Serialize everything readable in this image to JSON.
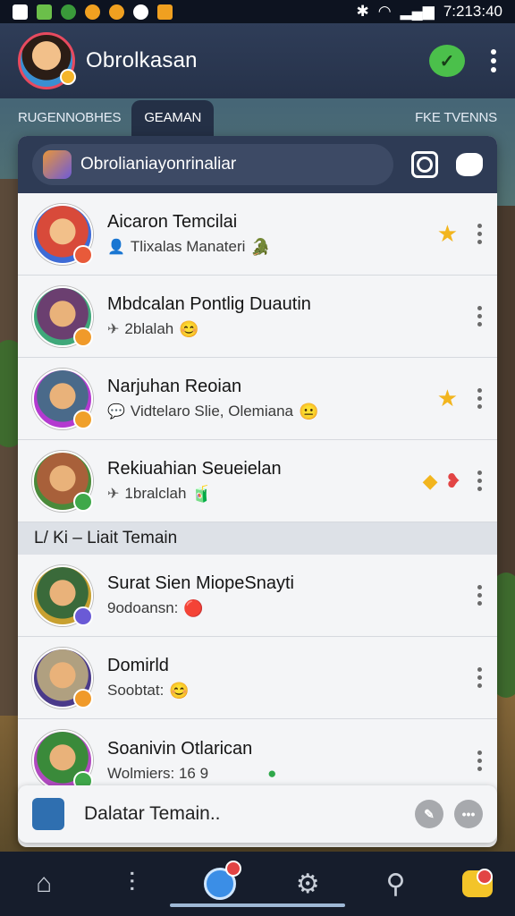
{
  "status_bar": {
    "time": "7:213:40"
  },
  "header": {
    "title": "Obrolkasan"
  },
  "tabs": [
    {
      "label": "RUGENNOBHES"
    },
    {
      "label": "GEAMAN"
    },
    {
      "label": "FKE TVENNS"
    }
  ],
  "search": {
    "text": "Obrolianiayonrinaliar"
  },
  "friends": [
    {
      "name": "Aicaron Temcilai",
      "status": "Tlixalas Manateri",
      "status_icon": "person-icon",
      "emoji": "🐊",
      "action_icon": "star-icon",
      "avatar_colors": [
        "#d84a3a",
        "#3e6bd6"
      ],
      "mini_color": "#e85a3a"
    },
    {
      "name": "Mbdcalan Pontlig Duautin",
      "status": "2blalah",
      "status_icon": "pin-icon",
      "emoji": "😊",
      "action_icon": "",
      "avatar_colors": [
        "#3fa87a",
        "#6b3fb0"
      ],
      "mini_color": "#f09a2a"
    },
    {
      "name": "Narjuhan Reoian",
      "status": "Vidtelaro Slie, Olemiana",
      "status_icon": "chat-icon",
      "emoji": "😐",
      "action_icon": "star-icon",
      "avatar_colors": [
        "#3a7ad0",
        "#b43ad0"
      ],
      "mini_color": "#f0a02a"
    },
    {
      "name": "Rekiuahian Seueielan",
      "status": "1bralclah",
      "status_icon": "pin-icon",
      "emoji": "🧃",
      "action_icon": "gift-icon",
      "avatar_colors": [
        "#a8603a",
        "#4a8a3a"
      ],
      "mini_color": "#3fa84a"
    }
  ],
  "section": {
    "label": "L/ Ki – Liait Temain"
  },
  "friends_2": [
    {
      "name": "Surat Sien MiopeSnayti",
      "status": "9odoansn:",
      "status_icon": "",
      "emoji": "🔴",
      "avatar_colors": [
        "#5a8a3a",
        "#c8a030"
      ],
      "mini_color": "#6a5ad6"
    },
    {
      "name": "Domirld",
      "status": "Soobtat:",
      "status_icon": "",
      "emoji": "😊",
      "avatar_colors": [
        "#c0b090",
        "#4a3a8a"
      ],
      "mini_color": "#f09a2a"
    },
    {
      "name": "Soanivin Otlarican",
      "status": "Wolmiers: 16 9",
      "status_icon": "",
      "emoji": "",
      "avatar_colors": [
        "#4aa84a",
        "#b04ac0"
      ],
      "mini_color": "#3fa84a"
    }
  ],
  "add_bar": {
    "label": "Dalatar Temain.."
  },
  "colors": {
    "accent": "#2e3b55",
    "primary_blue": "#3b8ee6",
    "star": "#f2b51e",
    "badge_red": "#e24444"
  }
}
